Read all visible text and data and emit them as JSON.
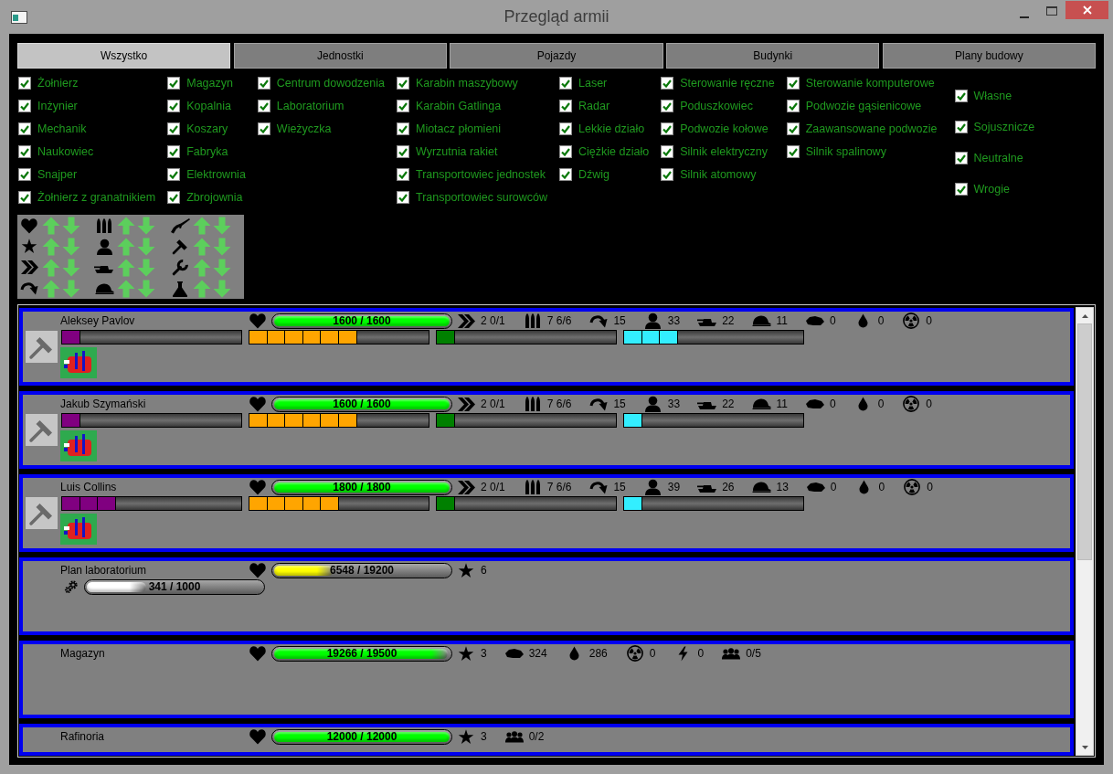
{
  "window": {
    "title": "Przegląd armii"
  },
  "tabs": [
    {
      "label": "Wszystko",
      "selected": true
    },
    {
      "label": "Jednostki",
      "selected": false
    },
    {
      "label": "Pojazdy",
      "selected": false
    },
    {
      "label": "Budynki",
      "selected": false
    },
    {
      "label": "Plany budowy",
      "selected": false
    }
  ],
  "type_filters": [
    {
      "items": [
        {
          "label": "Żołnierz",
          "checked": true
        },
        {
          "label": "Inżynier",
          "checked": true
        },
        {
          "label": "Mechanik",
          "checked": true
        },
        {
          "label": "Naukowiec",
          "checked": true
        },
        {
          "label": "Snajper",
          "checked": true
        },
        {
          "label": "Żołnierz z granatnikiem",
          "checked": true
        }
      ]
    },
    {
      "items": [
        {
          "label": "Magazyn",
          "checked": true
        },
        {
          "label": "Kopalnia",
          "checked": true
        },
        {
          "label": "Koszary",
          "checked": true
        },
        {
          "label": "Fabryka",
          "checked": true
        },
        {
          "label": "Elektrownia",
          "checked": true
        },
        {
          "label": "Zbrojownia",
          "checked": true
        }
      ]
    },
    {
      "items": [
        {
          "label": "Centrum dowodzenia",
          "checked": true
        },
        {
          "label": "Laboratorium",
          "checked": true
        },
        {
          "label": "Wieżyczka",
          "checked": true
        }
      ]
    },
    {
      "items": [
        {
          "label": "Karabin maszybowy",
          "checked": true
        },
        {
          "label": "Karabin Gatlinga",
          "checked": true
        },
        {
          "label": "Miotacz płomieni",
          "checked": true
        },
        {
          "label": "Wyrzutnia rakiet",
          "checked": true
        },
        {
          "label": "Transportowiec jednostek",
          "checked": true
        },
        {
          "label": "Transportowiec surowców",
          "checked": true
        }
      ]
    },
    {
      "items": [
        {
          "label": "Laser",
          "checked": true
        },
        {
          "label": "Radar",
          "checked": true
        },
        {
          "label": "Lekkie działo",
          "checked": true
        },
        {
          "label": "Ciężkie działo",
          "checked": true
        },
        {
          "label": "Dźwig",
          "checked": true
        }
      ]
    },
    {
      "items": [
        {
          "label": "Sterowanie ręczne",
          "checked": true
        },
        {
          "label": "Poduszkowiec",
          "checked": true
        },
        {
          "label": "Podwozie kołowe",
          "checked": true
        },
        {
          "label": "Silnik elektryczny",
          "checked": true
        },
        {
          "label": "Silnik atomowy",
          "checked": true
        }
      ]
    },
    {
      "items": [
        {
          "label": "Sterowanie komputerowe",
          "checked": true
        },
        {
          "label": "Podwozie gąsienicowe",
          "checked": true
        },
        {
          "label": "Zaawansowane podwozie",
          "checked": true
        },
        {
          "label": "Silnik spalinowy",
          "checked": true
        }
      ]
    }
  ],
  "allegiance_filters": [
    {
      "label": "Własne",
      "checked": true
    },
    {
      "label": "Sojusznicze",
      "checked": true
    },
    {
      "label": "Neutralne",
      "checked": true
    },
    {
      "label": "Wrogie",
      "checked": true
    }
  ],
  "sort_groups": [
    {
      "keys": [
        {
          "kind": "health"
        },
        {
          "kind": "rank"
        },
        {
          "kind": "speed"
        },
        {
          "kind": "range"
        }
      ]
    },
    {
      "keys": [
        {
          "kind": "ammo"
        },
        {
          "kind": "infantry"
        },
        {
          "kind": "armor"
        },
        {
          "kind": "defense"
        }
      ]
    },
    {
      "keys": [
        {
          "kind": "combat"
        },
        {
          "kind": "engineering"
        },
        {
          "kind": "mechanics"
        },
        {
          "kind": "science"
        }
      ]
    }
  ],
  "list": {
    "items": [
      {
        "kind": "unit",
        "name": "Aleksey Pavlov",
        "health": {
          "text": "1600 / 1600",
          "level": 1,
          "color": "#00ff00"
        },
        "stats": [
          {
            "kind": "speed",
            "value": "2 0/1"
          },
          {
            "kind": "ammo",
            "value": "7 6/6"
          },
          {
            "kind": "range",
            "value": "15"
          },
          {
            "kind": "infantry",
            "value": "33"
          },
          {
            "kind": "armor",
            "value": "22"
          },
          {
            "kind": "defense",
            "value": "11"
          },
          {
            "kind": "crates",
            "value": "0"
          },
          {
            "kind": "oil",
            "value": "0"
          },
          {
            "kind": "siberite",
            "value": "0"
          }
        ],
        "skills": [
          {
            "level": 0.1,
            "color": "#800080"
          },
          {
            "level": 0.6,
            "color": "#ffa500"
          },
          {
            "level": 0.1,
            "color": "#008000"
          },
          {
            "level": 0.3,
            "color": "#33eeff"
          }
        ]
      },
      {
        "kind": "unit",
        "name": "Jakub Szymański",
        "health": {
          "text": "1600 / 1600",
          "level": 1,
          "color": "#00ff00"
        },
        "stats": [
          {
            "kind": "speed",
            "value": "2 0/1"
          },
          {
            "kind": "ammo",
            "value": "7 6/6"
          },
          {
            "kind": "range",
            "value": "15"
          },
          {
            "kind": "infantry",
            "value": "33"
          },
          {
            "kind": "armor",
            "value": "22"
          },
          {
            "kind": "defense",
            "value": "11"
          },
          {
            "kind": "crates",
            "value": "0"
          },
          {
            "kind": "oil",
            "value": "0"
          },
          {
            "kind": "siberite",
            "value": "0"
          }
        ],
        "skills": [
          {
            "level": 0.1,
            "color": "#800080"
          },
          {
            "level": 0.6,
            "color": "#ffa500"
          },
          {
            "level": 0.1,
            "color": "#008000"
          },
          {
            "level": 0.1,
            "color": "#33eeff"
          }
        ]
      },
      {
        "kind": "unit",
        "name": "Luis Collins",
        "health": {
          "text": "1800 / 1800",
          "level": 1,
          "color": "#00ff00"
        },
        "stats": [
          {
            "kind": "speed",
            "value": "2 0/1"
          },
          {
            "kind": "ammo",
            "value": "7 6/6"
          },
          {
            "kind": "range",
            "value": "15"
          },
          {
            "kind": "infantry",
            "value": "39"
          },
          {
            "kind": "armor",
            "value": "26"
          },
          {
            "kind": "defense",
            "value": "13"
          },
          {
            "kind": "crates",
            "value": "0"
          },
          {
            "kind": "oil",
            "value": "0"
          },
          {
            "kind": "siberite",
            "value": "0"
          }
        ],
        "skills": [
          {
            "level": 0.3,
            "color": "#800080"
          },
          {
            "level": 0.5,
            "color": "#ffa500"
          },
          {
            "level": 0.1,
            "color": "#008000"
          },
          {
            "level": 0.1,
            "color": "#33eeff"
          }
        ]
      },
      {
        "kind": "plan",
        "name": "Plan laboratorium",
        "health": {
          "text": "6548 / 19200",
          "level": 0.34,
          "color": "#ffff00"
        },
        "stats": [
          {
            "kind": "rank",
            "value": "6"
          }
        ],
        "progress": {
          "text": "341 / 1000",
          "level": 0.341
        }
      },
      {
        "kind": "building",
        "name": "Magazyn",
        "health": {
          "text": "19266 / 19500",
          "level": 0.99,
          "color": "#00ff00"
        },
        "stats": [
          {
            "kind": "rank",
            "value": "3"
          },
          {
            "kind": "crates",
            "value": "324"
          },
          {
            "kind": "oil",
            "value": "286"
          },
          {
            "kind": "siberite",
            "value": "0"
          },
          {
            "kind": "power",
            "value": "0"
          },
          {
            "kind": "workers",
            "value": "0/5"
          }
        ]
      },
      {
        "kind": "building",
        "name": "Rafinoria",
        "health": {
          "text": "12000 / 12000",
          "level": 1,
          "color": "#00ff00"
        },
        "stats": [
          {
            "kind": "rank",
            "value": "3"
          },
          {
            "kind": "workers",
            "value": "0/2"
          }
        ]
      }
    ]
  }
}
